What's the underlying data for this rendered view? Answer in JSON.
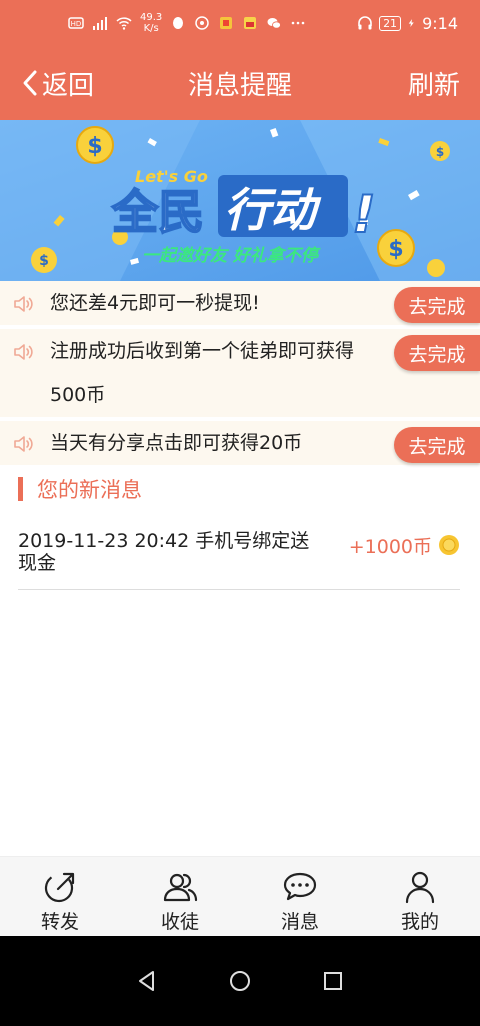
{
  "status": {
    "speed_top": "49.3",
    "speed_unit": "K/s",
    "battery": "21",
    "time": "9:14"
  },
  "nav": {
    "back_label": "返回",
    "title": "消息提醒",
    "refresh_label": "刷新"
  },
  "banner": {
    "lets_go": "Let's Go",
    "headline_left": "全民",
    "headline_right": "行动",
    "exclaim": "!",
    "subtitle": "一起邀好友 好礼拿不停"
  },
  "notices": [
    {
      "text": "您还差4元即可一秒提现!",
      "button": "去完成"
    },
    {
      "text": "注册成功后收到第一个徒弟即可获得500币",
      "button": "去完成"
    },
    {
      "text": "当天有分享点击即可获得20币",
      "button": "去完成"
    }
  ],
  "section": {
    "title": "您的新消息"
  },
  "messages": [
    {
      "text": "2019-11-23 20:42 手机号绑定送现金",
      "amount": "+1000币"
    }
  ],
  "tabs": [
    {
      "label": "转发",
      "icon": "share-icon"
    },
    {
      "label": "收徒",
      "icon": "users-icon"
    },
    {
      "label": "消息",
      "icon": "chat-icon"
    },
    {
      "label": "我的",
      "icon": "user-icon"
    }
  ],
  "colors": {
    "brand": "#eb6f57",
    "notice_bg": "#fdf8ef",
    "banner_blue": "#5aa7ef"
  }
}
